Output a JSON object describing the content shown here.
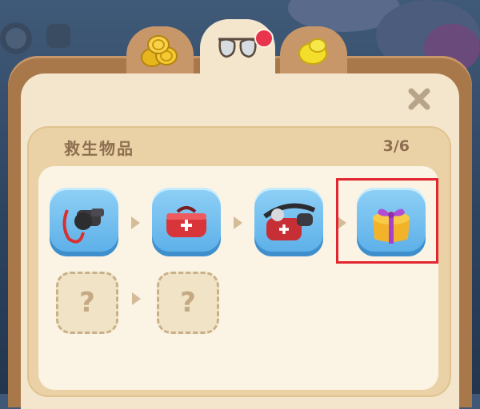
{
  "colors": {
    "frame": "#a9784a",
    "panel": "#f3e6cd",
    "card": "#ead2a6",
    "tile_blue": "#5aaee8",
    "badge": "#e8344d",
    "highlight": "#e2252f",
    "text": "#8d6e50"
  },
  "tabs": [
    {
      "icon": "gold-coins-icon",
      "active": false
    },
    {
      "icon": "sunglasses-icon",
      "active": true,
      "has_badge": true
    },
    {
      "icon": "lemon-icon",
      "active": false
    }
  ],
  "close_icon": "close-icon",
  "collection": {
    "title": "救生物品",
    "progress": "3/6",
    "items": [
      {
        "icon": "whistle-icon",
        "unlocked": true
      },
      {
        "icon": "first-aid-bag-icon",
        "unlocked": true
      },
      {
        "icon": "first-aid-waist-pack-icon",
        "unlocked": true
      },
      {
        "icon": "gift-box-icon",
        "unlocked": true,
        "selected": true
      },
      {
        "icon": "unknown-item-icon",
        "unlocked": false,
        "label": "?"
      },
      {
        "icon": "unknown-item-icon",
        "unlocked": false,
        "label": "?"
      }
    ]
  }
}
